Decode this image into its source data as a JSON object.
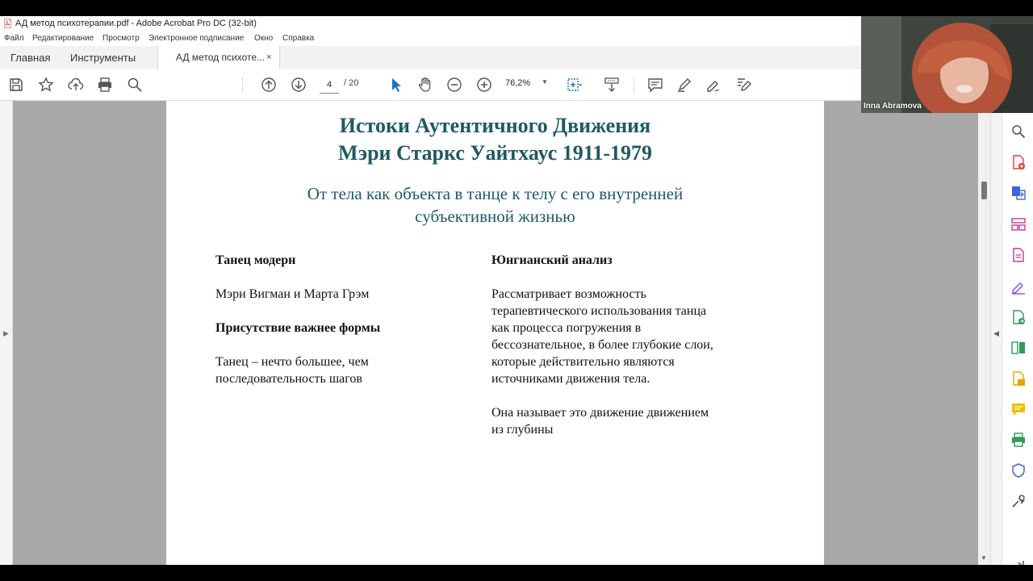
{
  "window": {
    "title": "АД метод психотерапии.pdf - Adobe Acrobat Pro DC (32-bit)"
  },
  "menu": [
    "Файл",
    "Редактирование",
    "Просмотр",
    "Электронное подписание",
    "Окно",
    "Справка"
  ],
  "tabs": {
    "home": "Главная",
    "tools": "Инструменты",
    "document": "АД метод психоте...",
    "close_glyph": "×"
  },
  "toolbar": {
    "page_current": "4",
    "page_total": "/ 20",
    "zoom": "76,2%",
    "icons": [
      "save-icon",
      "star-icon",
      "upload-icon",
      "print-icon",
      "search-icon",
      "prev-page-icon",
      "next-page-icon",
      "select-cursor-icon",
      "hand-icon",
      "zoom-out-icon",
      "zoom-in-icon",
      "fit-page-icon",
      "scroll-mode-icon",
      "comment-icon",
      "highlight-icon",
      "sign-icon",
      "edit-icon"
    ]
  },
  "video": {
    "participant_name": "Inna Abramova"
  },
  "document": {
    "title_line1": "Истоки Аутентичного Движения",
    "title_line2": "Мэри Старкс Уайтхаус  1911-1979",
    "subtitle_line1": "От тела как объекта в танце к телу с его внутренней",
    "subtitle_line2": "субъективной жизнью",
    "left": {
      "heading1": "Танец модерн",
      "line1": "Мэри Вигман и Марта Грэм",
      "heading2": "Присутствие важнее формы",
      "para_line1": "Танец – нечто большее, чем",
      "para_line2": "последовательность шагов"
    },
    "right": {
      "heading": "Юнгианский анализ",
      "p1_line1": "Рассматривает возможность",
      "p1_line2": "терапевтического использования танца",
      "p1_line3": "как процесса погружения в",
      "p1_line4": "бессознательное, в более глубокие слои,",
      "p1_line5": "которые действительно являются",
      "p1_line6": "источниками движения тела.",
      "p2_line1": "Она называет это движение движением",
      "p2_line2": "из глубины"
    }
  },
  "colors": {
    "title_teal": "#1f5a62",
    "accent_blue": "#1a73c9"
  }
}
